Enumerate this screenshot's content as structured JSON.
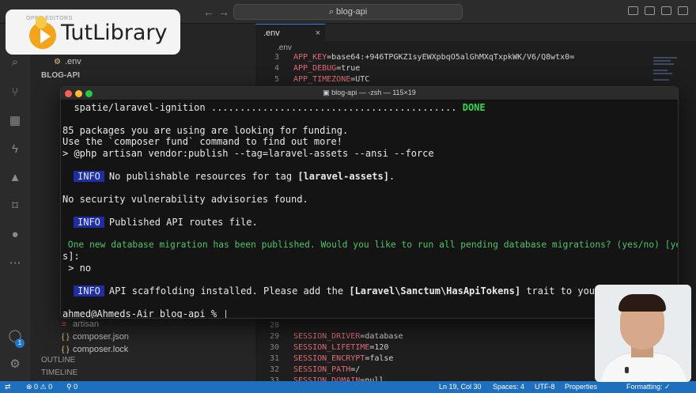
{
  "titlebar": {
    "search_text": "⌕ blog-api",
    "back_icon": "arrow-left-icon",
    "forward_icon": "arrow-right-icon"
  },
  "logo": {
    "small_text": "OPEN EDITORS",
    "name": "TutLibrary"
  },
  "sidebar": {
    "open_editors_file": ".env",
    "project_label": "BLOG-API",
    "files": [
      {
        "name": "artisan"
      },
      {
        "name": "composer.json",
        "icon": "{ }"
      },
      {
        "name": "composer.lock",
        "icon": "{ }"
      }
    ],
    "outline_label": "OUTLINE",
    "timeline_label": "TIMELINE"
  },
  "editor": {
    "tab_label": ".env",
    "breadcrumb": ".env",
    "top_lines": [
      {
        "n": "3",
        "key": "APP_KEY",
        "val": "=base64:+946TPGKZ1syEWXpbqO5alGhMXqTxpkWK/V6/Q8wtx0="
      },
      {
        "n": "4",
        "key": "APP_DEBUG",
        "val": "=true"
      },
      {
        "n": "5",
        "key": "APP_TIMEZONE",
        "val": "=UTC"
      }
    ],
    "bottom_lines": [
      {
        "n": "28",
        "key": "",
        "val": ""
      },
      {
        "n": "29",
        "key": "SESSION_DRIVER",
        "val": "=database"
      },
      {
        "n": "30",
        "key": "SESSION_LIFETIME",
        "val": "=120"
      },
      {
        "n": "31",
        "key": "SESSION_ENCRYPT",
        "val": "=false"
      },
      {
        "n": "32",
        "key": "SESSION_PATH",
        "val": "=/"
      },
      {
        "n": "33",
        "key": "SESSION_DOMAIN",
        "val": "=null"
      }
    ]
  },
  "terminal": {
    "title": "blog-api — -zsh — 115×19",
    "line_ignition": "  spatie/laravel-ignition ........................................... ",
    "done": "DONE",
    "line_funding": "85 packages you are using are looking for funding.",
    "line_fund_cmd": "Use the `composer fund` command to find out more!",
    "line_publish": "> @php artisan vendor:publish --tag=laravel-assets --ansi --force",
    "info_label": "INFO",
    "line_no_pub_a": "No publishable resources for tag ",
    "line_no_pub_b": "[laravel-assets]",
    "line_no_pub_c": ".",
    "line_security": "No security vulnerability advisories found.",
    "line_routes": "Published API routes file.",
    "line_migration": " One new database migration has been published. Would you like to run all pending database migrations? (yes/no) [ye",
    "line_migration_2": "s]:",
    "line_answer": " > no",
    "line_scaffold_a": "API scaffolding installed. Please add the ",
    "line_scaffold_b": "[Laravel\\Sanctum\\HasApiTokens]",
    "line_scaffold_c": " trait to your User",
    "prompt": "ahmed@Ahmeds-Air blog-api % "
  },
  "statusbar": {
    "problems": "⊗ 0 ⚠ 0",
    "ports": "⚲ 0",
    "position": "Ln 19, Col 30",
    "spaces": "Spaces: 4",
    "encoding": "UTF-8",
    "properties": "Properties",
    "formatting": "Formatting: ✓"
  },
  "account_badge": "1",
  "colors": {
    "status_bar": "#1f6fbf",
    "info_badge": "#1f2fa3",
    "done": "#32d74b"
  }
}
